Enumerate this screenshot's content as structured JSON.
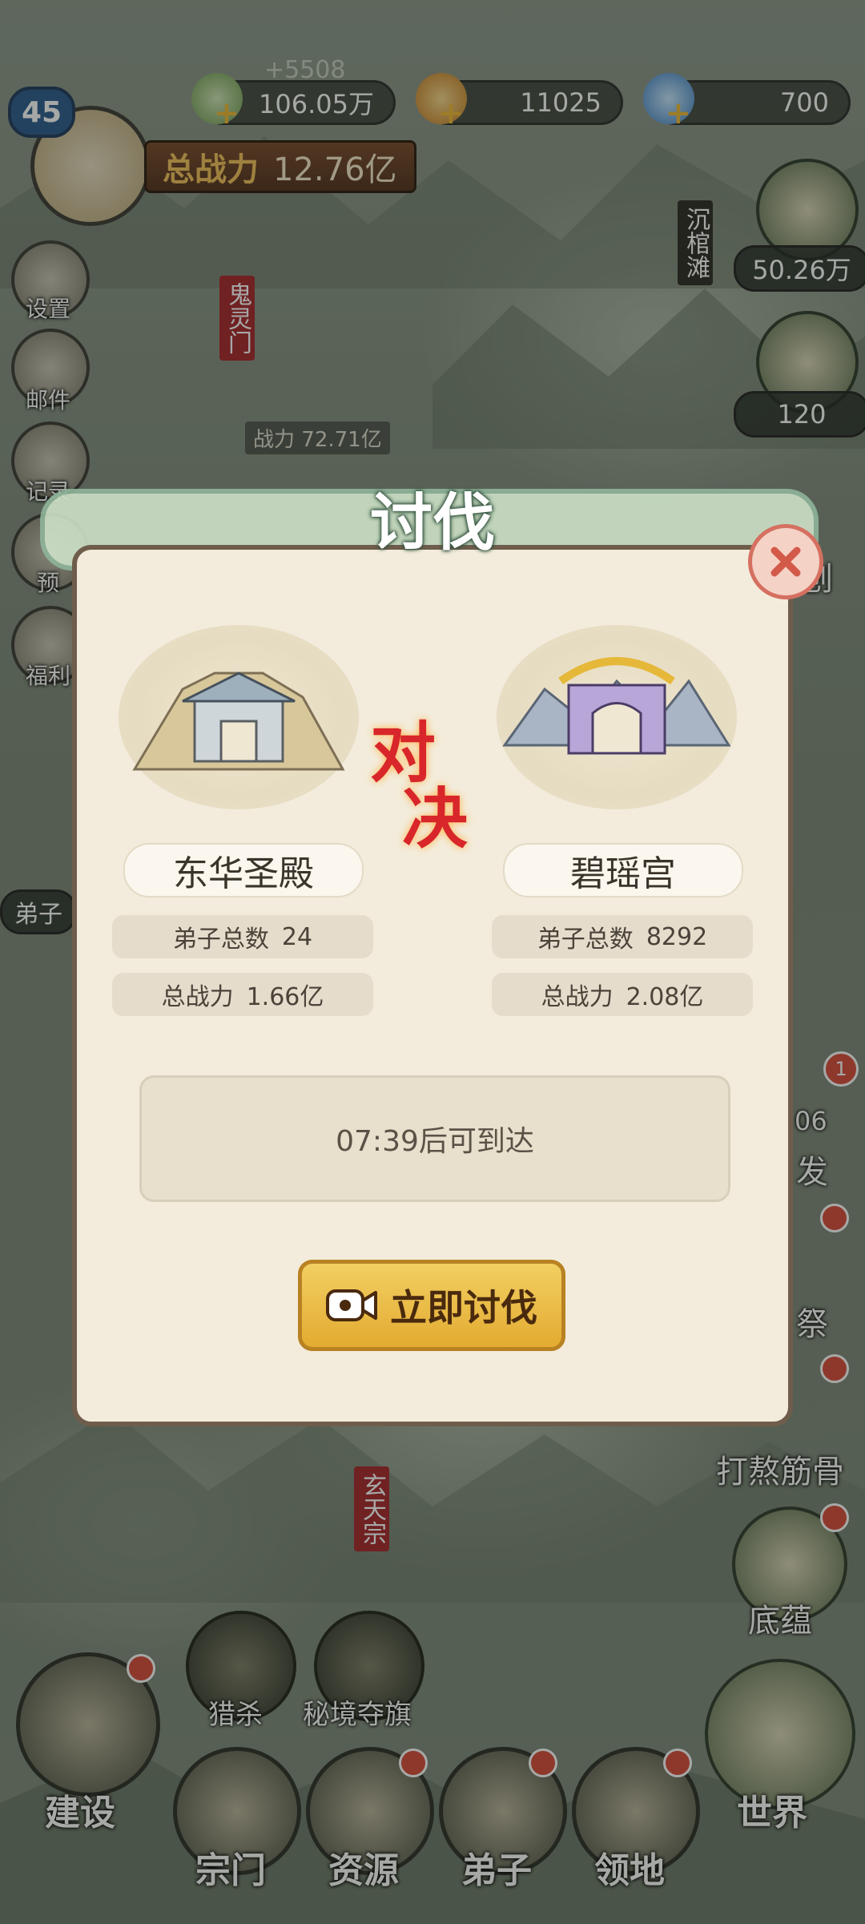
{
  "topbar": {
    "level": "45",
    "gain": "+5508",
    "power_label": "总战力",
    "power_value": "12.76亿",
    "resources": [
      {
        "icon": "herb-icon",
        "value": "106.05万"
      },
      {
        "icon": "ingot-icon",
        "value": "11025"
      },
      {
        "icon": "crystal-icon",
        "value": "700"
      }
    ]
  },
  "left_menu": {
    "items": [
      {
        "icon": "gear-icon",
        "label": "设置"
      },
      {
        "icon": "mail-icon",
        "label": "邮件"
      },
      {
        "icon": "record-icon",
        "label": "记录"
      },
      {
        "icon": "preview-icon",
        "label": "预"
      },
      {
        "icon": "gift-icon",
        "label": "福利"
      }
    ]
  },
  "right_panel": {
    "place_label": "沉棺滩",
    "bag1_value": "50.26万",
    "bag2_value": "120",
    "badge_count": "1",
    "partial_value": "06",
    "labels": {
      "item_a": "刨",
      "item_b": "发",
      "item_c": "祭",
      "item_d": "打熬筋骨",
      "item_e": "底蕴",
      "item_f": "世界"
    }
  },
  "map": {
    "sect_top": "鬼灵门",
    "sect_top_power_label": "战力",
    "sect_top_power": "72.71亿",
    "sect_bottom": "玄天宗",
    "left_partial": "弟子"
  },
  "dialog": {
    "title": "讨伐",
    "vs_text": [
      "对",
      "决"
    ],
    "left": {
      "name": "东华圣殿",
      "disciples_label": "弟子总数",
      "disciples": "24",
      "power_label": "总战力",
      "power": "1.66亿"
    },
    "right": {
      "name": "碧瑶宫",
      "disciples_label": "弟子总数",
      "disciples": "8292",
      "power_label": "总战力",
      "power": "2.08亿"
    },
    "arrival": "07:39后可到达",
    "action_button": "立即讨伐"
  },
  "bottom_nav": {
    "hunt": "猎杀",
    "flag": "秘境夺旗",
    "build": "建设",
    "sect": "宗门",
    "resources": "资源",
    "disciples": "弟子",
    "territory": "领地"
  },
  "colors": {
    "accent_gold": "#e3ab31",
    "dialog_bg": "#f3ecdc",
    "vs_red": "#d8262a",
    "badge_red": "#d84b3b"
  }
}
